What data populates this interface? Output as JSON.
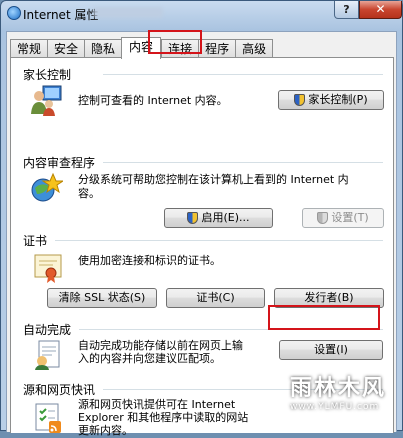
{
  "window": {
    "title": "Internet 属性",
    "help": "?",
    "close": "✕"
  },
  "tabs": [
    "常规",
    "安全",
    "隐私",
    "内容",
    "连接",
    "程序",
    "高级"
  ],
  "active_tab": "内容",
  "parental": {
    "title": "家长控制",
    "desc": "控制可查看的 Internet 内容。",
    "button": "家长控制(P)"
  },
  "advisor": {
    "title": "内容审查程序",
    "desc_line1": "分级系统可帮助您控制在该计算机上看到的 Internet 内",
    "desc_line2": "容。",
    "enable_button": "启用(E)...",
    "settings_button": "设置(T)"
  },
  "certs": {
    "title": "证书",
    "desc": "使用加密连接和标识的证书。",
    "clear_ssl": "清除 SSL 状态(S)",
    "certs_button": "证书(C)",
    "publishers_button": "发行者(B)"
  },
  "autocomplete": {
    "title": "自动完成",
    "desc_line1": "自动完成功能存储以前在网页上输",
    "desc_line2": "入的内容并向您建议匹配项。",
    "settings_button": "设置(I)"
  },
  "feeds": {
    "title": "源和网页快讯",
    "desc_line1": "源和网页快讯提供可在 Internet",
    "desc_line2": "Explorer 和其他程序中读取的网站",
    "desc_line3": "更新内容。"
  },
  "watermark": {
    "main": "雨林木风",
    "url": "www.YLMFU.com"
  },
  "colors": {
    "highlight": "#d4141a",
    "accent": "#2c62c5"
  }
}
